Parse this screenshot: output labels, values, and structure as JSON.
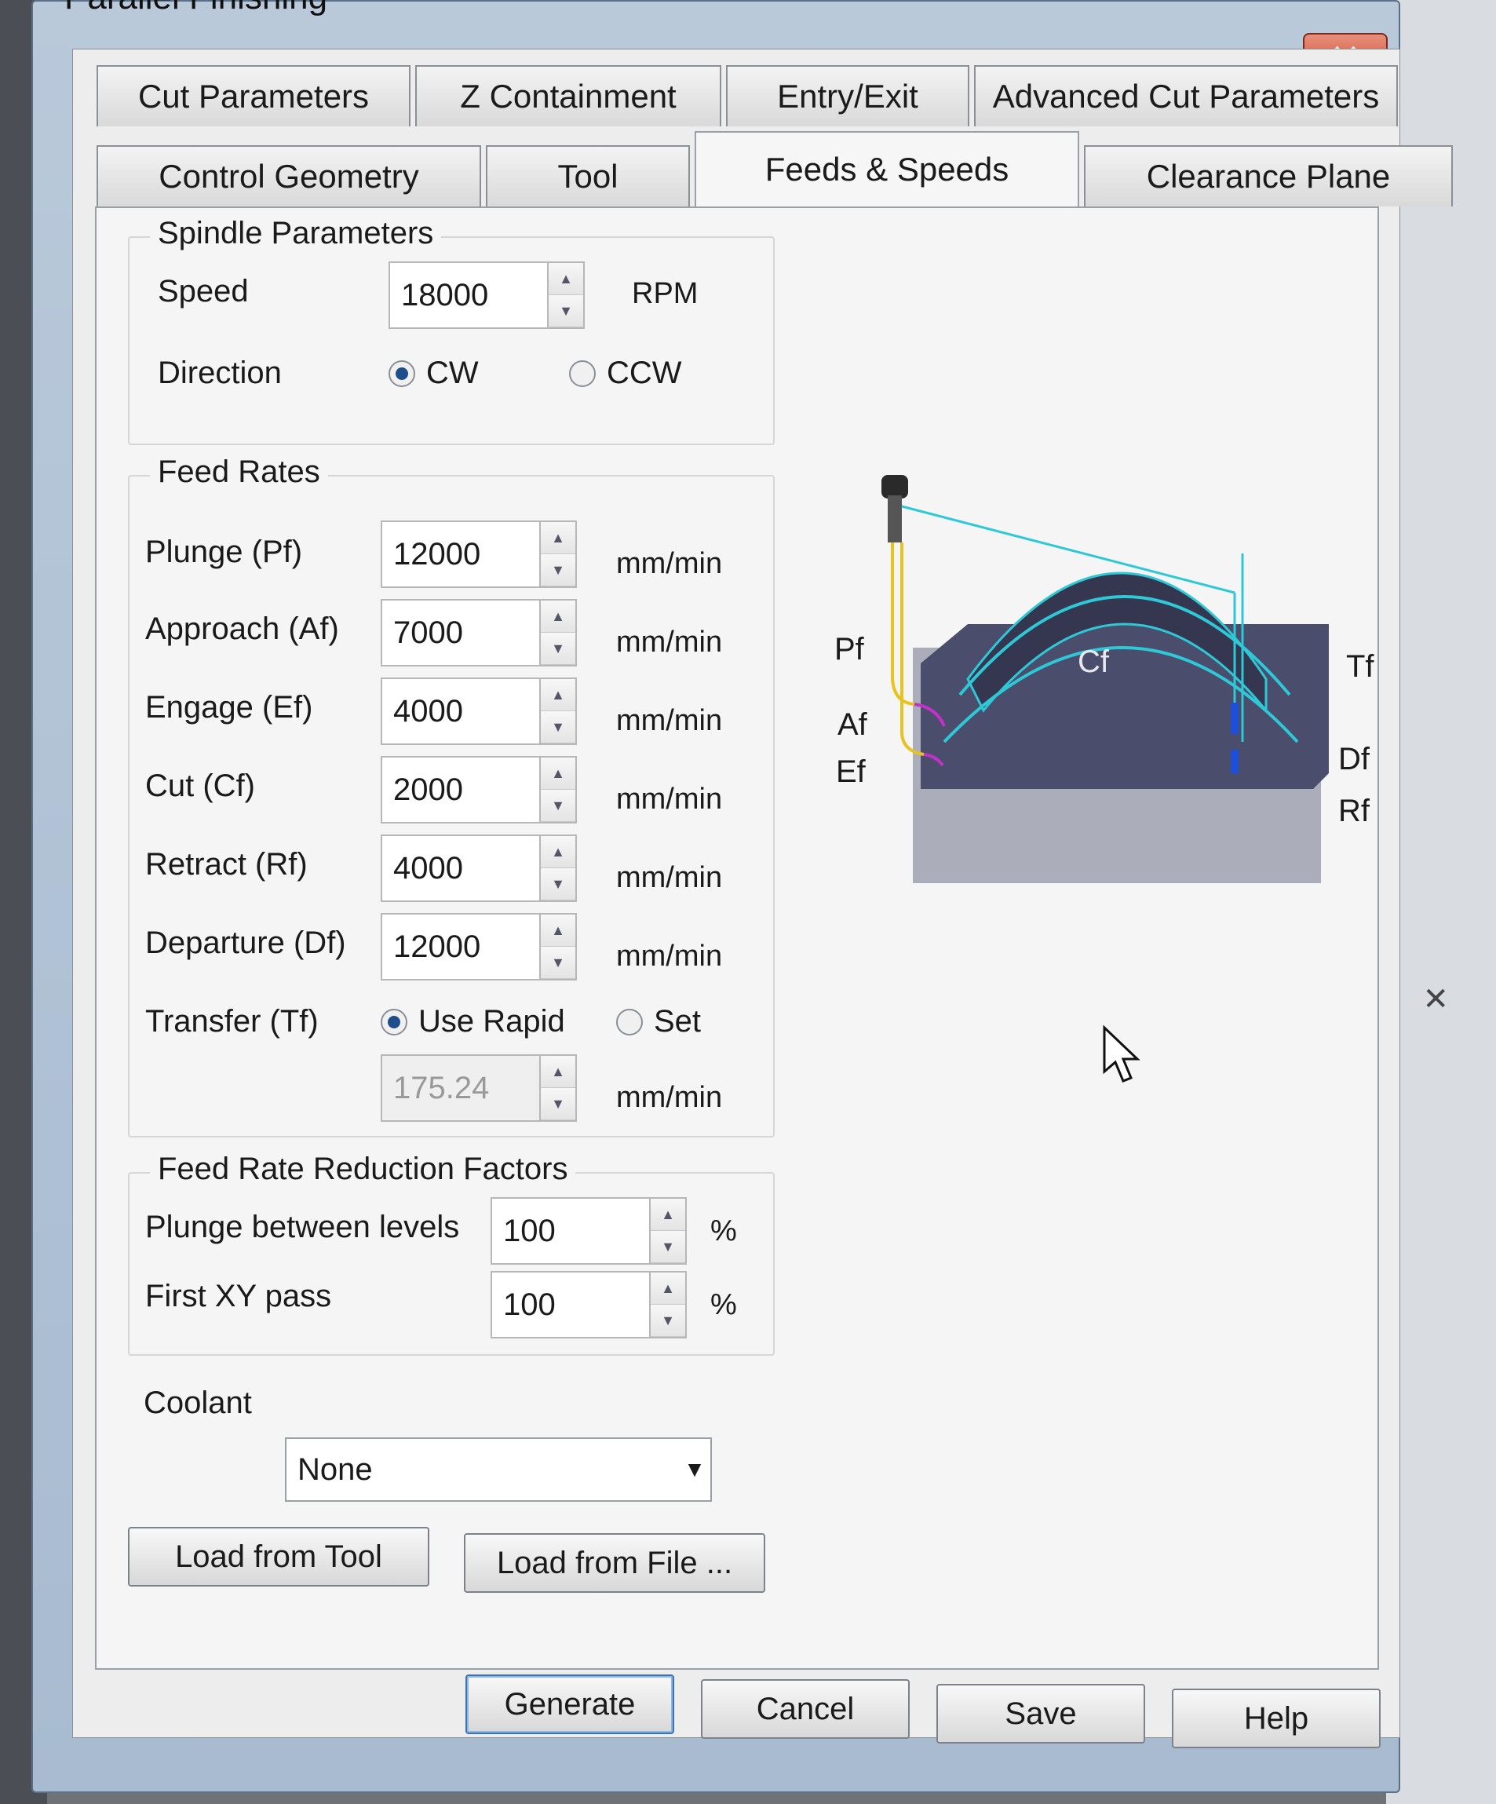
{
  "window": {
    "title": "Parallel Finishing"
  },
  "tabs": {
    "row1": [
      "Cut Parameters",
      "Z Containment",
      "Entry/Exit",
      "Advanced Cut Parameters"
    ],
    "row2": [
      "Control Geometry",
      "Tool",
      "Feeds & Speeds",
      "Clearance Plane"
    ],
    "active": "Feeds & Speeds"
  },
  "spindle": {
    "title": "Spindle Parameters",
    "speed_label": "Speed",
    "speed_value": "18000",
    "speed_unit": "RPM",
    "direction_label": "Direction",
    "cw_label": "CW",
    "ccw_label": "CCW",
    "selected": "CW"
  },
  "feed_rates": {
    "title": "Feed Rates",
    "rows": [
      {
        "label": "Plunge (Pf)",
        "value": "12000",
        "unit": "mm/min"
      },
      {
        "label": "Approach (Af)",
        "value": "7000",
        "unit": "mm/min"
      },
      {
        "label": "Engage (Ef)",
        "value": "4000",
        "unit": "mm/min"
      },
      {
        "label": "Cut (Cf)",
        "value": "2000",
        "unit": "mm/min"
      },
      {
        "label": "Retract (Rf)",
        "value": "4000",
        "unit": "mm/min"
      },
      {
        "label": "Departure  (Df)",
        "value": "12000",
        "unit": "mm/min"
      }
    ],
    "transfer_label": "Transfer (Tf)",
    "use_rapid_label": "Use Rapid",
    "set_label": "Set",
    "transfer_selected": "Use Rapid",
    "transfer_value": "175.24",
    "transfer_unit": "mm/min"
  },
  "reduction": {
    "title": "Feed Rate Reduction Factors",
    "plunge_label": "Plunge between levels",
    "plunge_value": "100",
    "first_xy_label": "First XY pass",
    "first_xy_value": "100",
    "unit": "%"
  },
  "coolant": {
    "label": "Coolant",
    "selected": "None"
  },
  "buttons": {
    "load_tool": "Load from Tool",
    "load_file": "Load from File ...",
    "generate": "Generate",
    "cancel": "Cancel",
    "save": "Save",
    "help": "Help"
  },
  "diagram": {
    "labels": {
      "pf": "Pf",
      "af": "Af",
      "ef": "Ef",
      "cf": "Cf",
      "tf": "Tf",
      "df": "Df",
      "rf": "Rf"
    }
  },
  "icons": [
    "close-icon",
    "spin-up-icon",
    "spin-down-icon",
    "chevron-down-icon",
    "mouse-cursor-icon"
  ],
  "colors": {
    "toolpath_cyan": "#2ec8d6",
    "toolpath_yellow": "#e7c31f",
    "toolpath_magenta": "#c232c9",
    "part": "#3b3e57"
  }
}
